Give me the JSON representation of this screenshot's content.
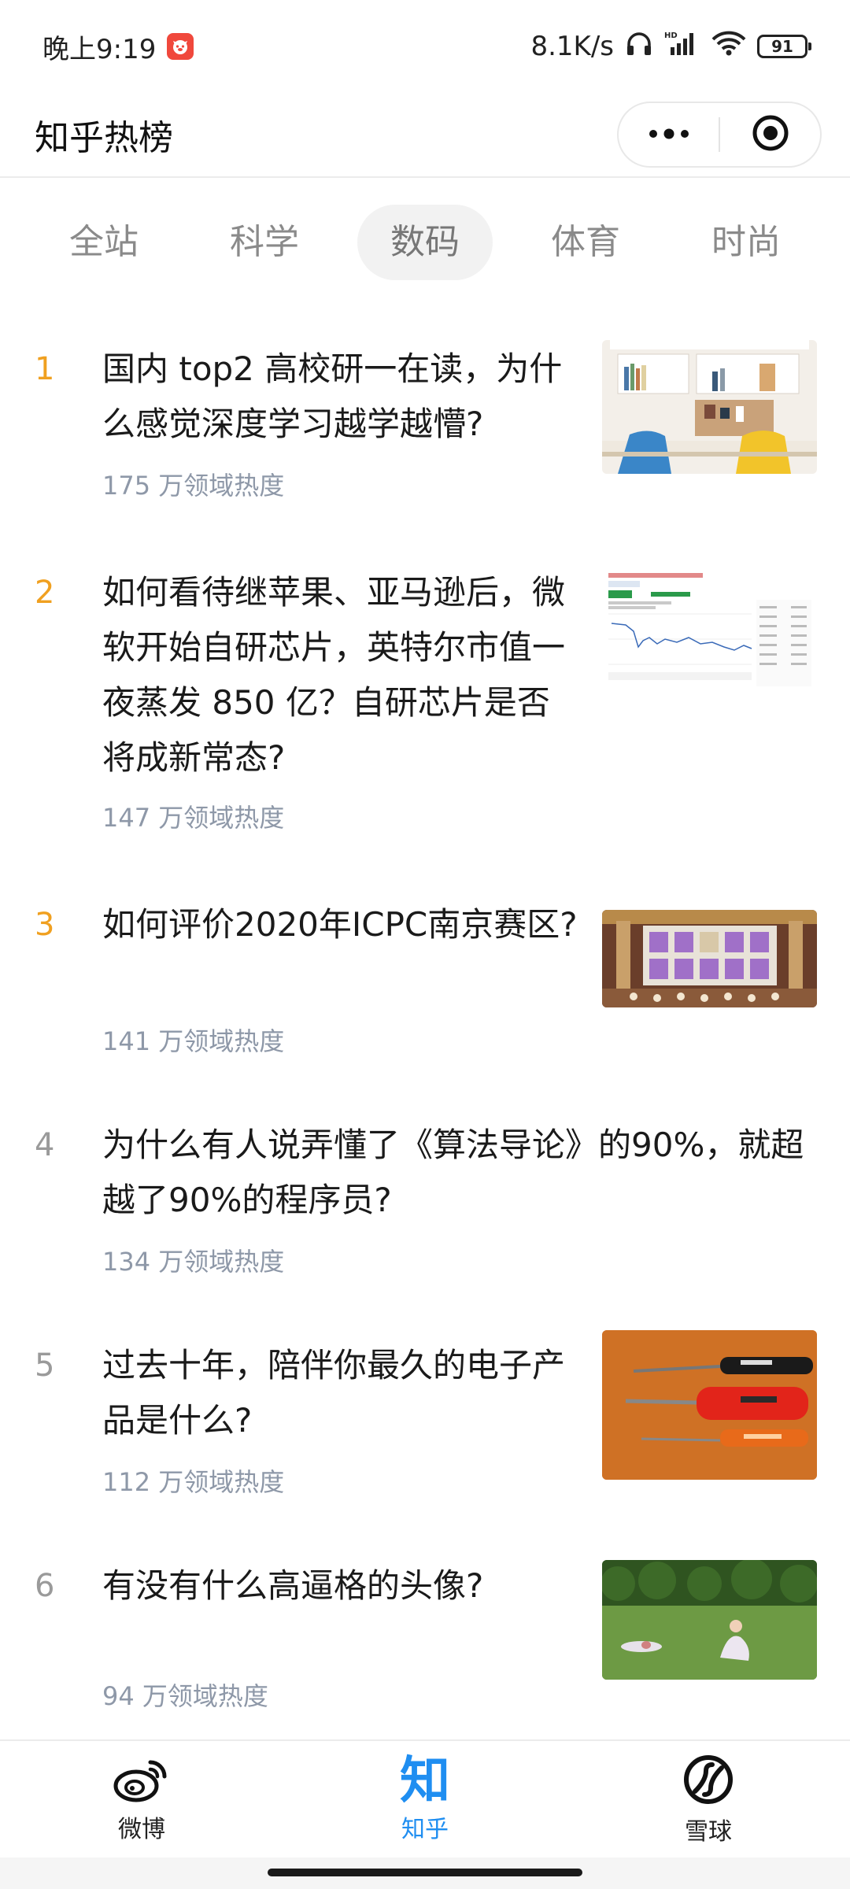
{
  "status_bar": {
    "time": "晚上9:19",
    "network_speed": "8.1K/s",
    "battery": "91",
    "icons": [
      "app-notification-icon",
      "headphones-icon",
      "hd-signal-icon",
      "wifi-icon",
      "battery-icon"
    ]
  },
  "header": {
    "title": "知乎热榜",
    "more_icon": "more-dots-icon",
    "close_icon": "target-circle-icon"
  },
  "tabs": [
    {
      "label": "全站",
      "active": false
    },
    {
      "label": "科学",
      "active": false
    },
    {
      "label": "数码",
      "active": true
    },
    {
      "label": "体育",
      "active": false
    },
    {
      "label": "时尚",
      "active": false
    }
  ],
  "items": [
    {
      "rank": "1",
      "title": "国内 top2 高校研一在读，为什么感觉深度学习越学越懵?",
      "heat": "175 万领域热度",
      "thumb": "study-desk-photo"
    },
    {
      "rank": "2",
      "title": "如何看待继苹果、亚马逊后，微软开始自研芯片，英特尔市值一夜蒸发 850 亿？自研芯片是否将成新常态?",
      "heat": "147 万领域热度",
      "thumb": "stock-chart-screenshot"
    },
    {
      "rank": "3",
      "title": "如何评价2020年ICPC南京赛区?",
      "heat": "141 万领域热度",
      "thumb": "game-screenshot"
    },
    {
      "rank": "4",
      "title": "为什么有人说弄懂了《算法导论》的90%，就超越了90%的程序员?",
      "heat": "134 万领域热度",
      "thumb": ""
    },
    {
      "rank": "5",
      "title": "过去十年，陪伴你最久的电子产品是什么?",
      "heat": "112 万领域热度",
      "thumb": "screwdrivers-photo"
    },
    {
      "rank": "6",
      "title": "有没有什么高逼格的头像?",
      "heat": "94 万领域热度",
      "thumb": "garden-photo"
    }
  ],
  "bottom_nav": [
    {
      "label": "微博",
      "icon": "weibo-icon",
      "active": false
    },
    {
      "label": "知乎",
      "icon": "zhihu-icon",
      "active": true
    },
    {
      "label": "雪球",
      "icon": "xueqiu-icon",
      "active": false
    }
  ],
  "colors": {
    "hot_rank": "#f0a020",
    "normal_rank": "#9a9a9a",
    "heat_text": "#8e98a8",
    "active_nav": "#1f8ef1"
  }
}
